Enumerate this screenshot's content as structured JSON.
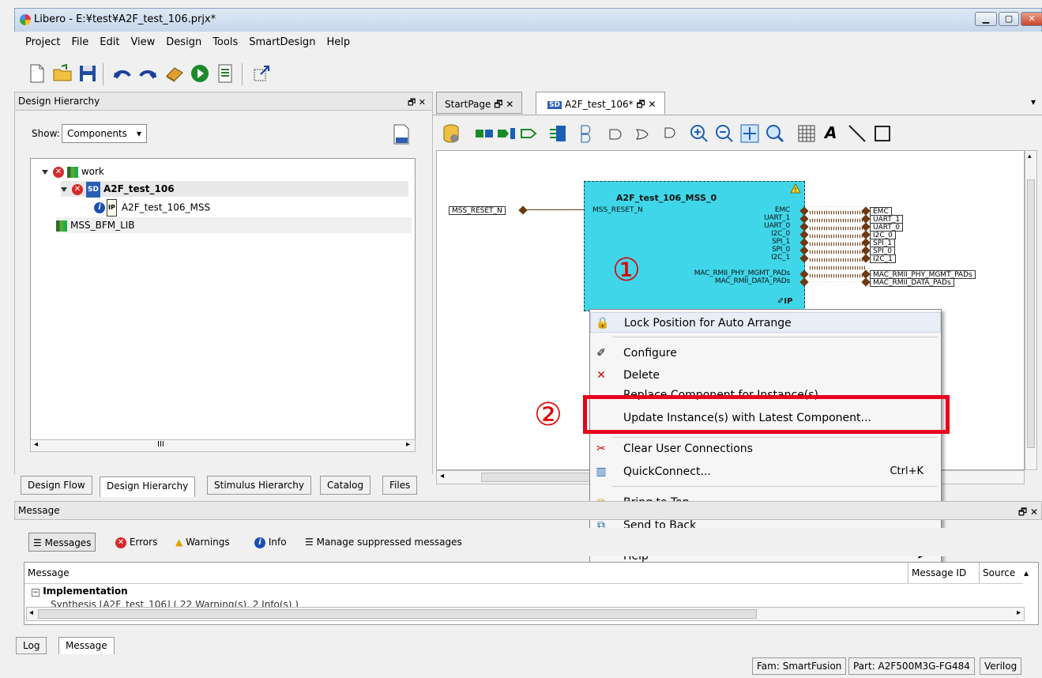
{
  "window": {
    "title": "Libero - E:¥test¥A2F_test_106.prjx*"
  },
  "menu": [
    "Project",
    "File",
    "Edit",
    "View",
    "Design",
    "Tools",
    "SmartDesign",
    "Help"
  ],
  "left_panel": {
    "title": "Design Hierarchy",
    "show_label": "Show:",
    "show_value": "Components",
    "tree": {
      "work": "work",
      "a2f": "A2F_test_106",
      "mss": "A2F_test_106_MSS",
      "bfm": "MSS_BFM_LIB"
    },
    "tabs": [
      "Design Flow",
      "Design Hierarchy",
      "Stimulus Hierarchy",
      "Catalog",
      "Files"
    ]
  },
  "doc_tabs": {
    "start": "StartPage",
    "design": "A2F_test_106*"
  },
  "canvas": {
    "component_title": "A2F_test_106_MSS_0",
    "input_port": "MSS_RESET_N",
    "external_input": "MSS_RESET_N",
    "output_ports": [
      "EMC",
      "UART_1",
      "UART_0",
      "I2C_0",
      "SPI_1",
      "SPI_0",
      "I2C_1",
      "MAC_RMII_PHY_MGMT_PADs",
      "MAC_RMII_DATA_PADs"
    ],
    "output_labels": [
      "EMC",
      "UART_1",
      "UART_0",
      "I2C_0",
      "SPI_1",
      "SPI_0",
      "I2C_1",
      "MAC_RMII_PHY_MGMT_PADs",
      "MAC_RMII_DATA_PADs"
    ],
    "marker_1": "①",
    "marker_2": "②"
  },
  "context_menu": {
    "lock": "Lock Position for Auto Arrange",
    "configure": "Configure",
    "delete": "Delete",
    "replace": "Replace Component for Instance(s)...",
    "update": "Update Instance(s) with Latest Component...",
    "clear": "Clear User Connections",
    "quickconnect": "QuickConnect...",
    "quickconnect_shortcut": "Ctrl+K",
    "bring_top": "Bring to Top",
    "send_back": "Send to Back",
    "help": "Help"
  },
  "message_panel": {
    "title": "Message",
    "filters": {
      "messages": "Messages",
      "errors": "Errors",
      "warnings": "Warnings",
      "info": "Info",
      "manage": "Manage suppressed messages"
    },
    "columns": {
      "message": "Message",
      "message_id": "Message ID",
      "source": "Source"
    },
    "row_group": "Implementation",
    "row_detail": "Synthesis [A2F_test_106] ( 22 Warning(s), 2 Info(s) )"
  },
  "bottom_tabs": [
    "Log",
    "Message"
  ],
  "status": {
    "family": "Fam: SmartFusion",
    "part": "Part: A2F500M3G-FG484",
    "lang": "Verilog"
  }
}
